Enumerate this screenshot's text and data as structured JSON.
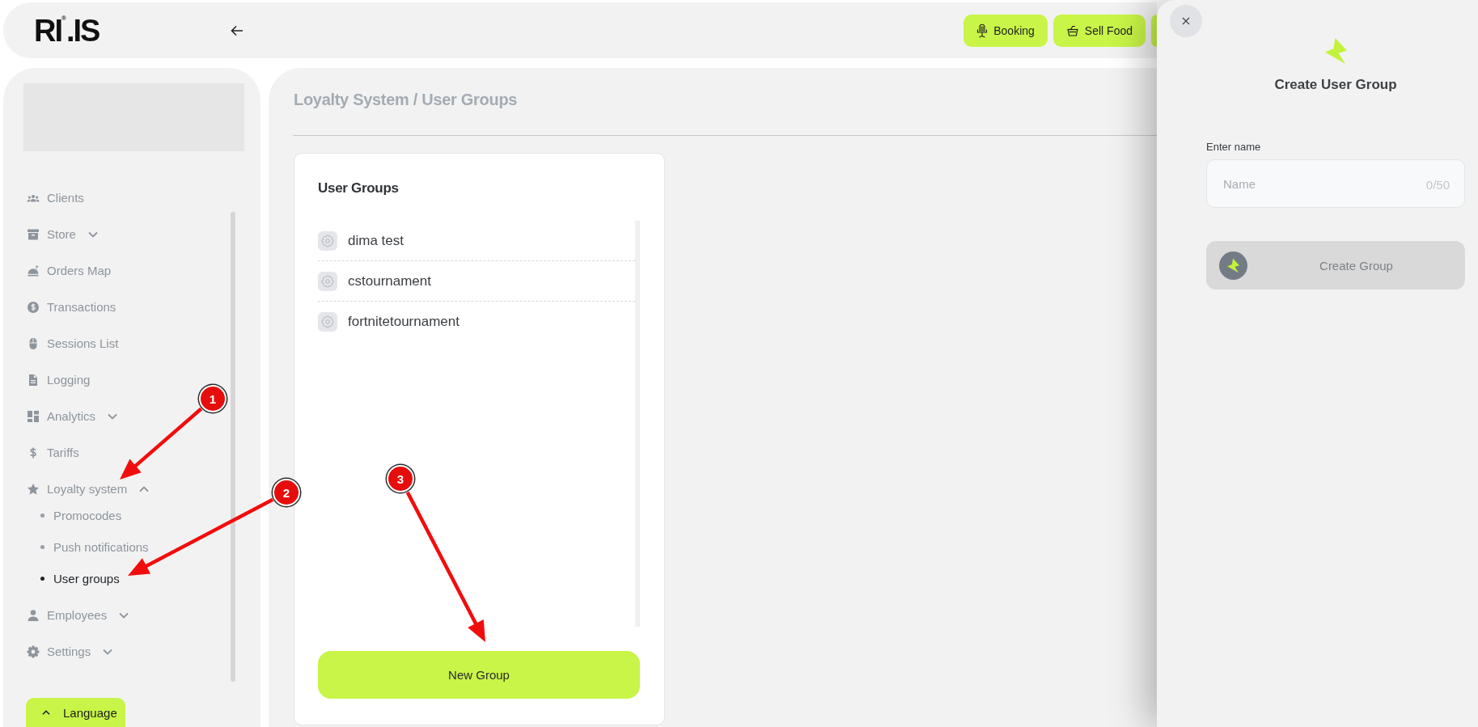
{
  "header": {
    "logo": "RI$^{®}$.IS",
    "buttons": [
      {
        "kind": "full",
        "label": "Booking"
      },
      {
        "kind": "full",
        "label": "Sell Food"
      },
      {
        "kind": "cut"
      }
    ]
  },
  "sidebar": {
    "items": [
      {
        "label": "Clients",
        "selected": false
      },
      {
        "label": "Store",
        "selected": false,
        "expanded": false
      },
      {
        "label": "Orders Map",
        "selected": false
      },
      {
        "label": "Transactions",
        "selected": false
      },
      {
        "label": "Sessions List",
        "selected": false
      },
      {
        "label": "Logging",
        "selected": false
      },
      {
        "label": "Analytics",
        "selected": false,
        "expanded": false
      },
      {
        "label": "Tariffs",
        "selected": false
      },
      {
        "label": "Loyalty system",
        "selected": false,
        "expanded": true,
        "children": [
          {
            "label": "Promocodes",
            "selected": false
          },
          {
            "label": "Push notifications",
            "selected": false
          },
          {
            "label": "User groups",
            "selected": true
          }
        ]
      },
      {
        "label": "Employees",
        "selected": false,
        "expanded": false
      },
      {
        "label": "Settings",
        "selected": false,
        "expanded": false
      }
    ],
    "language_button": "Language"
  },
  "main": {
    "breadcrumb": "Loyalty System / User Groups",
    "card": {
      "title": "User Groups",
      "groups": [
        {
          "name": "dima test"
        },
        {
          "name": "cstournament"
        },
        {
          "name": "fortnitetournament"
        }
      ],
      "new_button": "New Group"
    }
  },
  "panel": {
    "title": "Create User Group",
    "field": {
      "label": "Enter name",
      "placeholder": "Name",
      "counter": "0/50"
    },
    "submit": {
      "label": "Create Group",
      "disabled": true
    }
  },
  "annotations": [
    {
      "number": "1"
    },
    {
      "number": "2"
    },
    {
      "number": "3"
    }
  ]
}
